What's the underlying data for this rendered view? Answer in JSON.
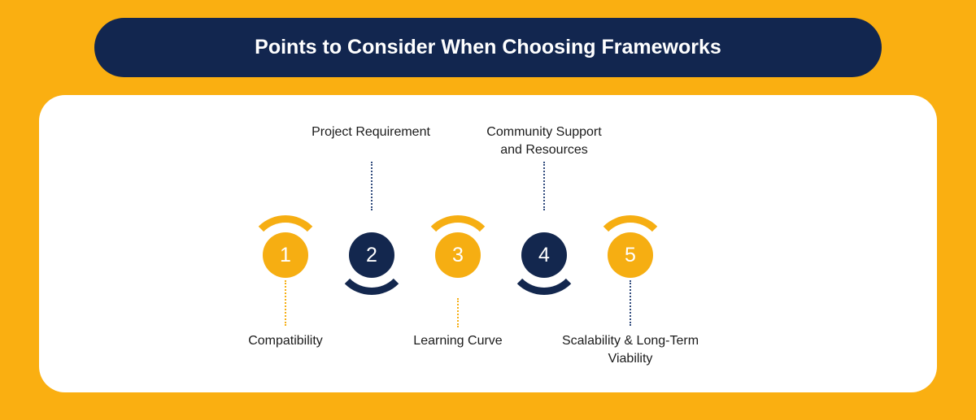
{
  "title": "Points to Consider When Choosing Frameworks",
  "colors": {
    "accent": "#F6AE12",
    "navy": "#13274E",
    "bg": "#FAAF11"
  },
  "nodes": [
    {
      "num": "1",
      "label": "Compatibility",
      "pos": "bottom",
      "style": "yellow"
    },
    {
      "num": "2",
      "label": "Project Requirement",
      "pos": "top",
      "style": "navy"
    },
    {
      "num": "3",
      "label": "Learning Curve",
      "pos": "bottom",
      "style": "yellow"
    },
    {
      "num": "4",
      "label": "Community Support and Resources",
      "pos": "top",
      "style": "navy"
    },
    {
      "num": "5",
      "label": "Scalability & Long-Term Viability",
      "pos": "bottom",
      "style": "yellow"
    }
  ],
  "chart_data": {
    "type": "table",
    "title": "Points to Consider When Choosing Frameworks",
    "categories": [
      "1",
      "2",
      "3",
      "4",
      "5"
    ],
    "values": [
      "Compatibility",
      "Project Requirement",
      "Learning Curve",
      "Community Support and Resources",
      "Scalability & Long-Term Viability"
    ]
  }
}
